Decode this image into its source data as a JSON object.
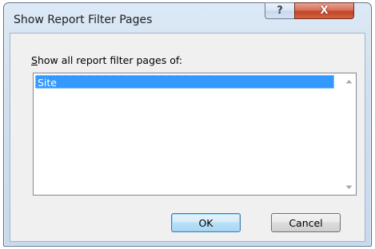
{
  "dialog": {
    "title": "Show Report Filter Pages",
    "help_glyph": "?",
    "close_glyph": "X",
    "label_accelerator": "S",
    "label_rest": "how all report filter pages of:",
    "list_items": [
      {
        "label": "Site",
        "selected": true
      }
    ],
    "ok_label": "OK",
    "cancel_label": "Cancel"
  },
  "colors": {
    "selection": "#3399ff",
    "close_button": "#c3442a",
    "dialog_face": "#f0f0f0"
  },
  "icons": {
    "scroll_up": "chevron-up-icon",
    "scroll_down": "chevron-down-icon"
  }
}
